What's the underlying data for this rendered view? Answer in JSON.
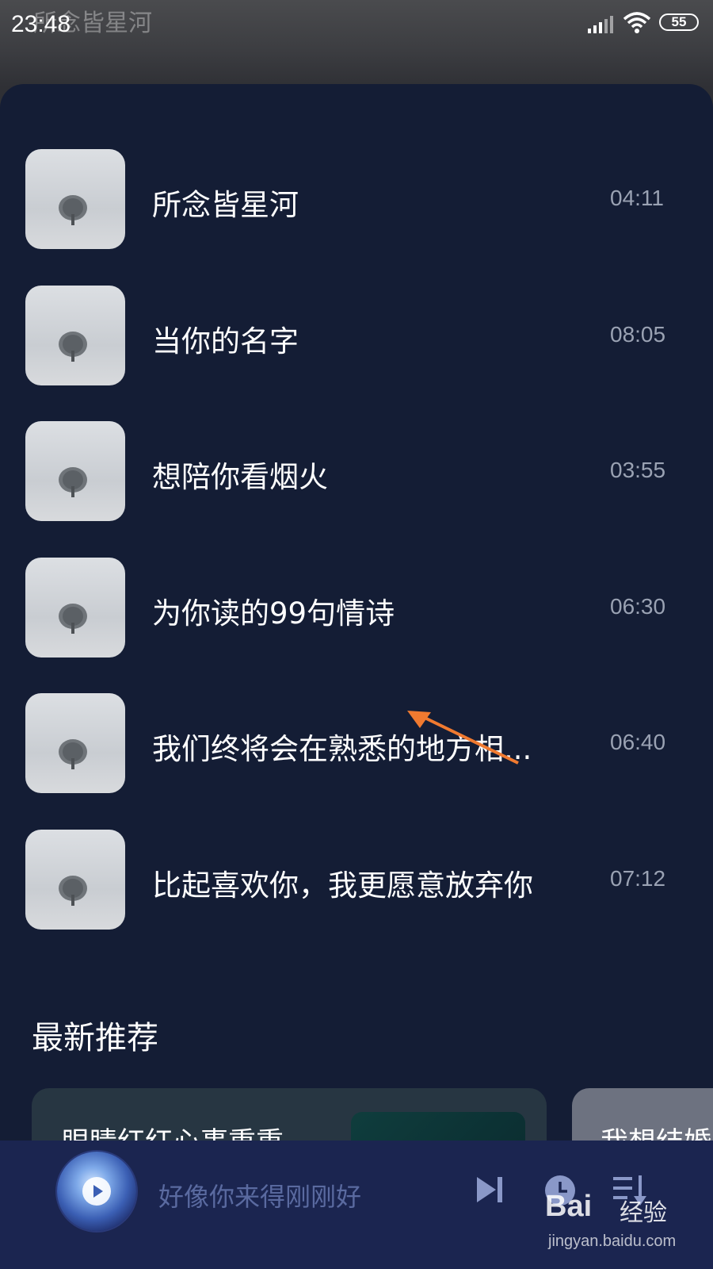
{
  "status_bar": {
    "time": "23:48",
    "background_title": "所念皆星河",
    "battery": "55",
    "icons": [
      "signal-icon",
      "wifi-icon",
      "battery-icon"
    ]
  },
  "tracks": [
    {
      "title": "所念皆星河",
      "duration": "04:11"
    },
    {
      "title": "当你的名字",
      "duration": "08:05"
    },
    {
      "title": "想陪你看烟火",
      "duration": "03:55"
    },
    {
      "title": "为你读的99句情诗",
      "duration": "06:30"
    },
    {
      "title": "我们终将会在熟悉的地方相...",
      "duration": "06:40"
    },
    {
      "title": "比起喜欢你，我更愿意放弃你",
      "duration": "07:12"
    }
  ],
  "recommend": {
    "section_title": "最新推荐",
    "cards": [
      {
        "title": "眼睛红红心事重重"
      },
      {
        "title": "我想结婚"
      }
    ]
  },
  "player": {
    "now_playing": "好像你来得刚刚好",
    "icons": [
      "play-icon",
      "next-icon",
      "timer-icon",
      "playlist-icon"
    ]
  },
  "watermark": {
    "logo": "Bai",
    "brand": "经验",
    "url": "jingyan.baidu.com"
  },
  "colors": {
    "sheet_bg": "#141d35",
    "player_bg": "#1b2550",
    "annotation_arrow": "#f07a30",
    "duration_text": "#9aa2b3"
  }
}
